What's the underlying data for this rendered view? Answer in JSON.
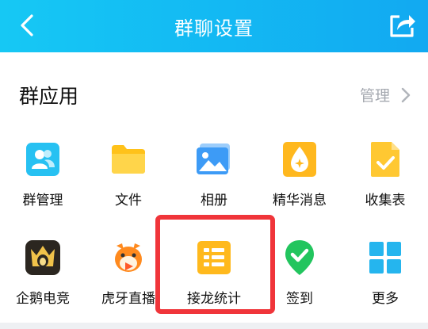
{
  "header": {
    "title": "群聊设置",
    "back_icon": "chevron-left-icon",
    "share_icon": "share-icon",
    "bg_color_start": "#16c8f4",
    "bg_color_end": "#12a9f1"
  },
  "section": {
    "title": "群应用",
    "manage_label": "管理",
    "manage_icon": "chevron-right-icon"
  },
  "apps": [
    {
      "label": "群管理",
      "icon": "group-manage-icon",
      "color": "#27c1f2"
    },
    {
      "label": "文件",
      "icon": "folder-icon",
      "color": "#ffc21a"
    },
    {
      "label": "相册",
      "icon": "photo-album-icon",
      "color": "#3d9bf6"
    },
    {
      "label": "精华消息",
      "icon": "essence-drop-icon",
      "color": "#ffb81e"
    },
    {
      "label": "收集表",
      "icon": "form-check-icon",
      "color": "#ffc832"
    },
    {
      "label": "企鹅电竞",
      "icon": "penguin-esports-icon",
      "color": "#2b2620"
    },
    {
      "label": "虎牙直播",
      "icon": "huya-tiger-icon",
      "color": "#ff8a1e"
    },
    {
      "label": "接龙统计",
      "icon": "relay-stats-icon",
      "color": "#ffb91d"
    },
    {
      "label": "签到",
      "icon": "checkin-pin-icon",
      "color": "#22c55e"
    },
    {
      "label": "更多",
      "icon": "more-grid-icon",
      "color": "#25b5ee"
    }
  ],
  "highlight_color": "#f0353a"
}
